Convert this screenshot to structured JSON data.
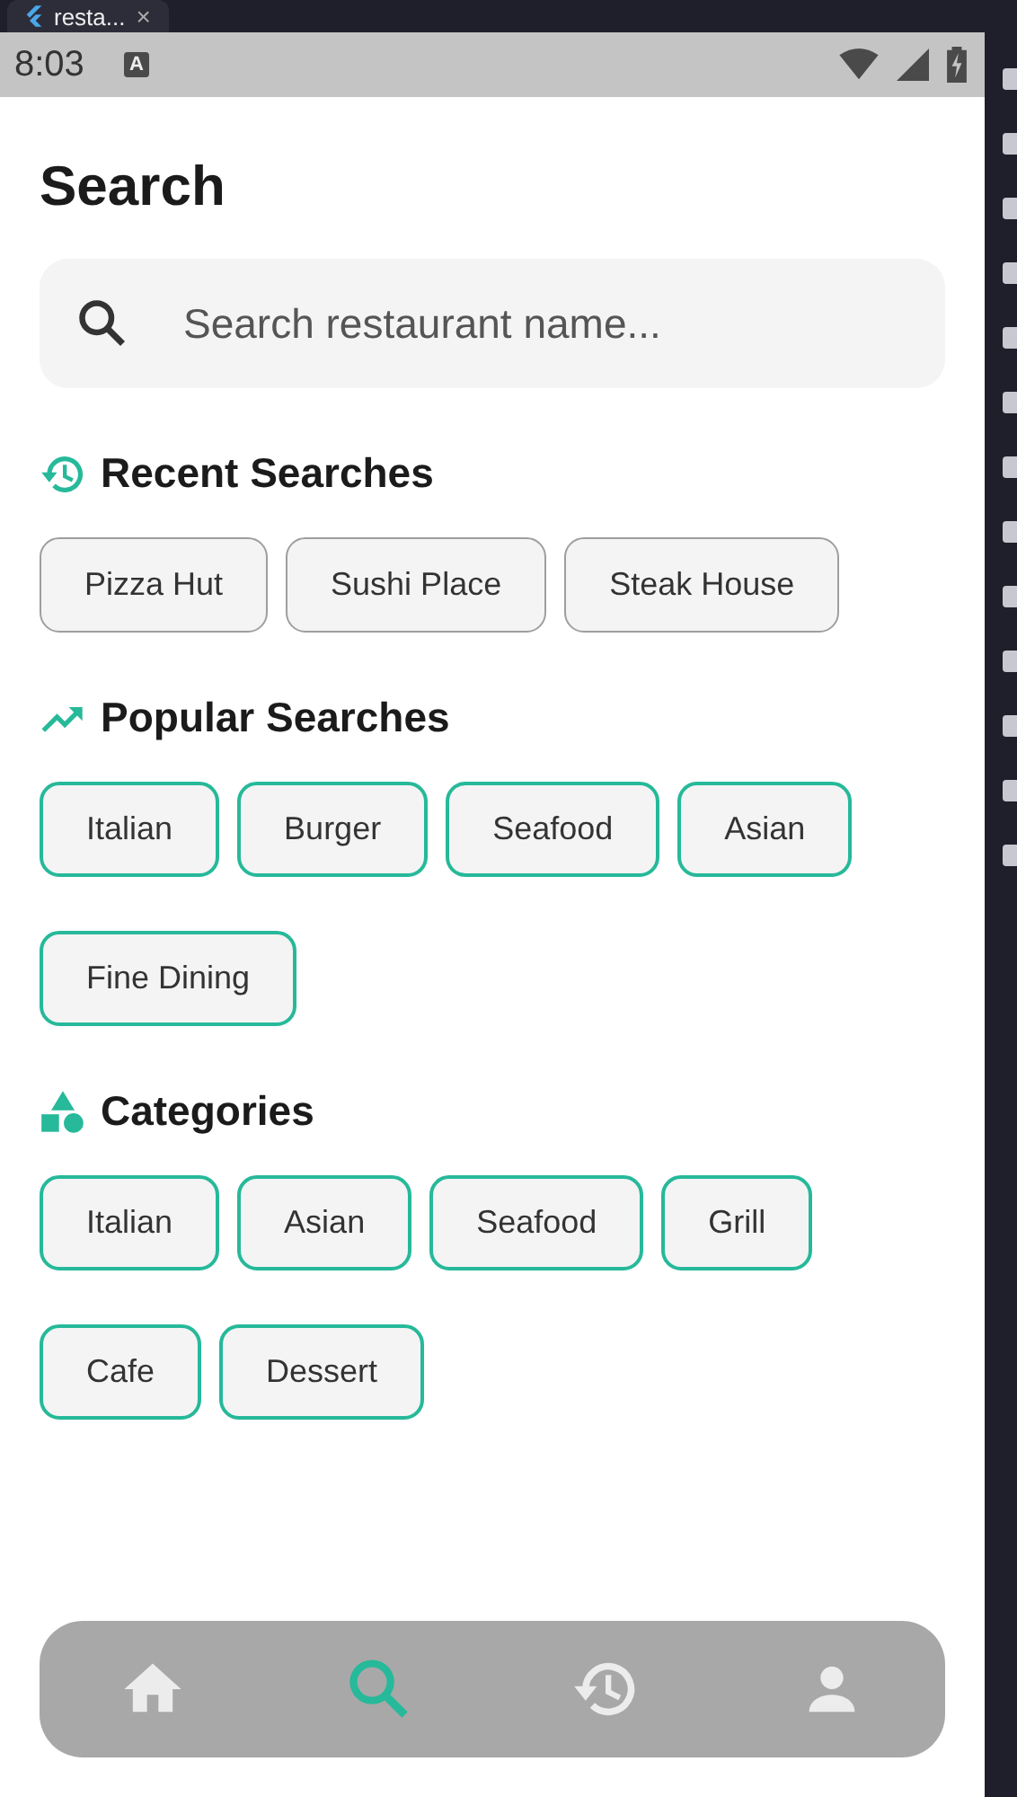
{
  "window": {
    "tab_title": "resta...",
    "close": "×"
  },
  "status_bar": {
    "time": "8:03",
    "notice": "A"
  },
  "title": "Search",
  "search": {
    "placeholder": "Search restaurant name..."
  },
  "sections": [
    {
      "kind": "recent",
      "title": "Recent Searches",
      "chips": [
        "Pizza Hut",
        "Sushi Place",
        "Steak House"
      ]
    },
    {
      "kind": "popular",
      "title": "Popular Searches",
      "chips": [
        "Italian",
        "Burger",
        "Seafood",
        "Asian",
        "Fine Dining"
      ]
    },
    {
      "kind": "categories",
      "title": "Categories",
      "chips": [
        "Italian",
        "Asian",
        "Seafood",
        "Grill",
        "Cafe",
        "Dessert"
      ]
    }
  ],
  "nav": [
    {
      "kind": "home",
      "selected": false
    },
    {
      "kind": "search",
      "selected": true
    },
    {
      "kind": "history",
      "selected": false
    },
    {
      "kind": "profile",
      "selected": false
    }
  ]
}
